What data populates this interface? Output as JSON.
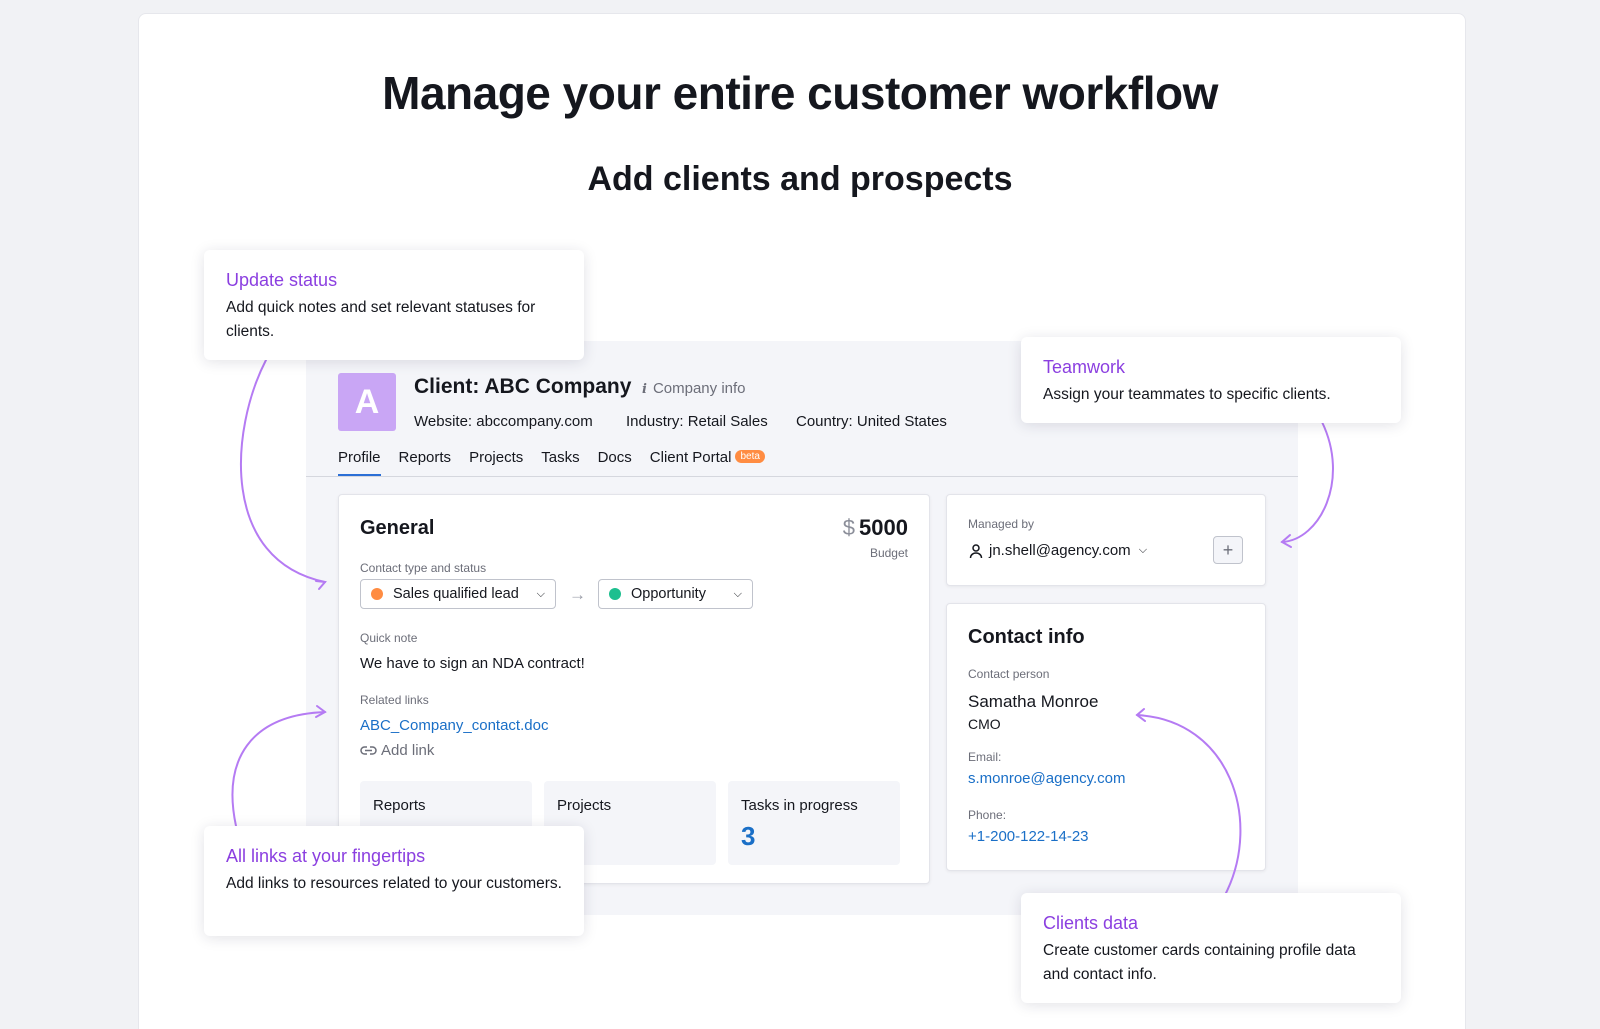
{
  "page": {
    "headline": "Manage your entire customer workflow",
    "subheadline": "Add clients and prospects"
  },
  "client": {
    "avatar_letter": "A",
    "title": "Client: ABC Company",
    "company_info_label": "Company info",
    "website": "Website: abccompany.com",
    "industry": "Industry: Retail Sales",
    "country": "Country: United States"
  },
  "tabs": [
    {
      "label": "Profile",
      "active": true
    },
    {
      "label": "Reports"
    },
    {
      "label": "Projects"
    },
    {
      "label": "Tasks"
    },
    {
      "label": "Docs"
    },
    {
      "label": "Client Portal",
      "badge": "beta"
    }
  ],
  "general": {
    "title": "General",
    "budget_currency": "$",
    "budget_amount": "5000",
    "budget_label": "Budget",
    "contact_type_label": "Contact type and status",
    "contact_type": {
      "value": "Sales qualified lead",
      "dot_color": "#ff8c42"
    },
    "status": {
      "value": "Opportunity",
      "dot_color": "#1dbf8f"
    },
    "quick_note_label": "Quick note",
    "quick_note": "We have to sign an NDA contract!",
    "related_links_label": "Related links",
    "related_link": "ABC_Company_contact.doc",
    "add_link_label": "Add link",
    "stats": [
      {
        "label": "Reports",
        "value": ""
      },
      {
        "label": "Projects",
        "value": ""
      },
      {
        "label": "Tasks in progress",
        "value": "3"
      }
    ]
  },
  "managed": {
    "label": "Managed by",
    "user": "jn.shell@agency.com",
    "add_symbol": "+"
  },
  "contact": {
    "title": "Contact info",
    "person_label": "Contact person",
    "person_name": "Samatha Monroe",
    "person_role": "CMO",
    "email_label": "Email:",
    "email": "s.monroe@agency.com",
    "phone_label": "Phone:",
    "phone": "+1-200-122-14-23"
  },
  "callouts": {
    "update_status": {
      "title": "Update status",
      "desc": "Add quick notes and set relevant statuses for clients."
    },
    "teamwork": {
      "title": "Teamwork",
      "desc": "Assign your teammates to specific clients."
    },
    "links": {
      "title": "All links at your fingertips",
      "desc": "Add links to resources related to your customers."
    },
    "clients_data": {
      "title": "Clients data",
      "desc": "Create customer cards containing profile data and contact info."
    }
  },
  "colors": {
    "accent_purple": "#8b3fe0",
    "link_blue": "#1a6fc7",
    "avatar_bg": "#c9a6f5",
    "arrow_purple": "#b57bf3"
  },
  "icons": [
    "info-icon",
    "chevron-down-icon",
    "arrow-right-icon",
    "link-icon",
    "user-icon",
    "plus-icon",
    "curved-arrow-icon"
  ]
}
